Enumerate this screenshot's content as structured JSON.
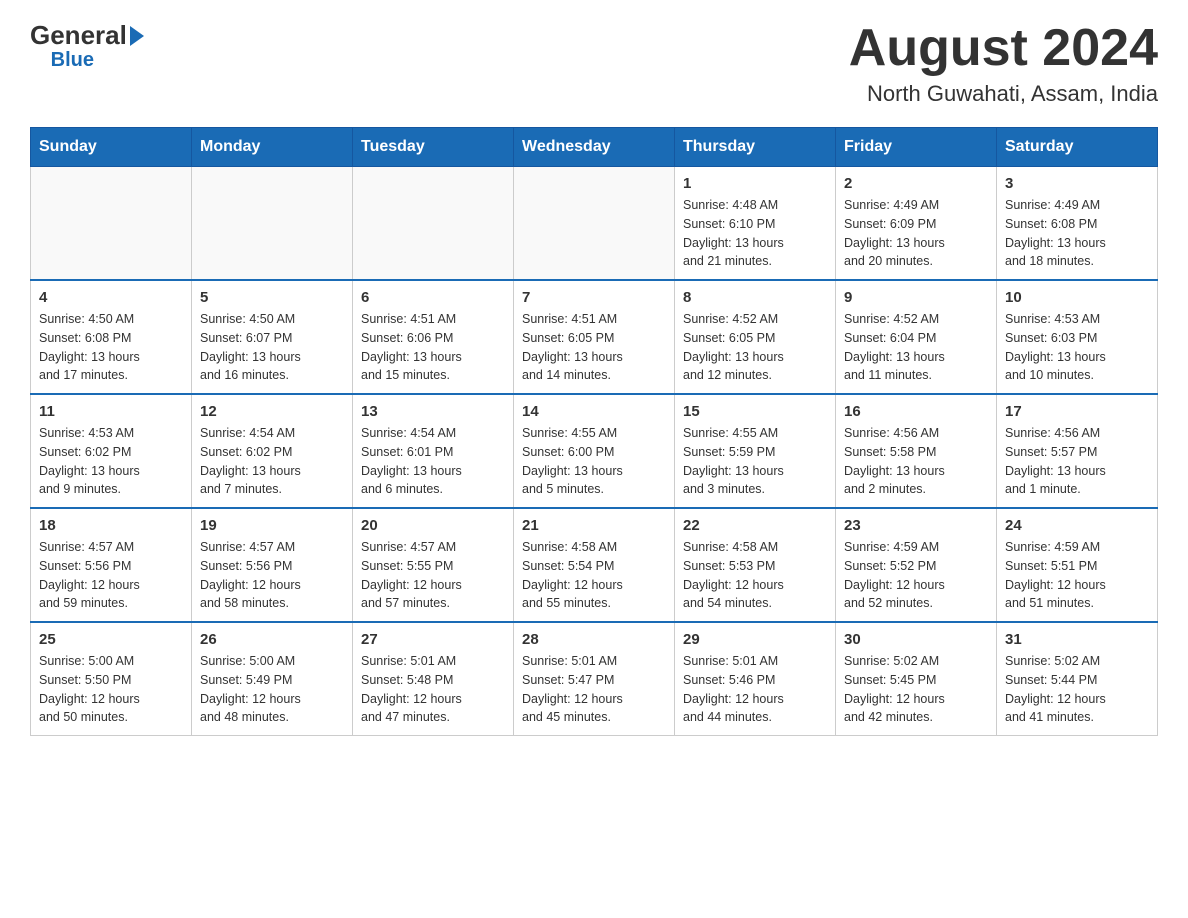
{
  "header": {
    "logo_general": "General",
    "logo_blue": "Blue",
    "main_title": "August 2024",
    "subtitle": "North Guwahati, Assam, India"
  },
  "days_of_week": [
    "Sunday",
    "Monday",
    "Tuesday",
    "Wednesday",
    "Thursday",
    "Friday",
    "Saturday"
  ],
  "weeks": [
    {
      "days": [
        {
          "number": "",
          "info": ""
        },
        {
          "number": "",
          "info": ""
        },
        {
          "number": "",
          "info": ""
        },
        {
          "number": "",
          "info": ""
        },
        {
          "number": "1",
          "info": "Sunrise: 4:48 AM\nSunset: 6:10 PM\nDaylight: 13 hours\nand 21 minutes."
        },
        {
          "number": "2",
          "info": "Sunrise: 4:49 AM\nSunset: 6:09 PM\nDaylight: 13 hours\nand 20 minutes."
        },
        {
          "number": "3",
          "info": "Sunrise: 4:49 AM\nSunset: 6:08 PM\nDaylight: 13 hours\nand 18 minutes."
        }
      ]
    },
    {
      "days": [
        {
          "number": "4",
          "info": "Sunrise: 4:50 AM\nSunset: 6:08 PM\nDaylight: 13 hours\nand 17 minutes."
        },
        {
          "number": "5",
          "info": "Sunrise: 4:50 AM\nSunset: 6:07 PM\nDaylight: 13 hours\nand 16 minutes."
        },
        {
          "number": "6",
          "info": "Sunrise: 4:51 AM\nSunset: 6:06 PM\nDaylight: 13 hours\nand 15 minutes."
        },
        {
          "number": "7",
          "info": "Sunrise: 4:51 AM\nSunset: 6:05 PM\nDaylight: 13 hours\nand 14 minutes."
        },
        {
          "number": "8",
          "info": "Sunrise: 4:52 AM\nSunset: 6:05 PM\nDaylight: 13 hours\nand 12 minutes."
        },
        {
          "number": "9",
          "info": "Sunrise: 4:52 AM\nSunset: 6:04 PM\nDaylight: 13 hours\nand 11 minutes."
        },
        {
          "number": "10",
          "info": "Sunrise: 4:53 AM\nSunset: 6:03 PM\nDaylight: 13 hours\nand 10 minutes."
        }
      ]
    },
    {
      "days": [
        {
          "number": "11",
          "info": "Sunrise: 4:53 AM\nSunset: 6:02 PM\nDaylight: 13 hours\nand 9 minutes."
        },
        {
          "number": "12",
          "info": "Sunrise: 4:54 AM\nSunset: 6:02 PM\nDaylight: 13 hours\nand 7 minutes."
        },
        {
          "number": "13",
          "info": "Sunrise: 4:54 AM\nSunset: 6:01 PM\nDaylight: 13 hours\nand 6 minutes."
        },
        {
          "number": "14",
          "info": "Sunrise: 4:55 AM\nSunset: 6:00 PM\nDaylight: 13 hours\nand 5 minutes."
        },
        {
          "number": "15",
          "info": "Sunrise: 4:55 AM\nSunset: 5:59 PM\nDaylight: 13 hours\nand 3 minutes."
        },
        {
          "number": "16",
          "info": "Sunrise: 4:56 AM\nSunset: 5:58 PM\nDaylight: 13 hours\nand 2 minutes."
        },
        {
          "number": "17",
          "info": "Sunrise: 4:56 AM\nSunset: 5:57 PM\nDaylight: 13 hours\nand 1 minute."
        }
      ]
    },
    {
      "days": [
        {
          "number": "18",
          "info": "Sunrise: 4:57 AM\nSunset: 5:56 PM\nDaylight: 12 hours\nand 59 minutes."
        },
        {
          "number": "19",
          "info": "Sunrise: 4:57 AM\nSunset: 5:56 PM\nDaylight: 12 hours\nand 58 minutes."
        },
        {
          "number": "20",
          "info": "Sunrise: 4:57 AM\nSunset: 5:55 PM\nDaylight: 12 hours\nand 57 minutes."
        },
        {
          "number": "21",
          "info": "Sunrise: 4:58 AM\nSunset: 5:54 PM\nDaylight: 12 hours\nand 55 minutes."
        },
        {
          "number": "22",
          "info": "Sunrise: 4:58 AM\nSunset: 5:53 PM\nDaylight: 12 hours\nand 54 minutes."
        },
        {
          "number": "23",
          "info": "Sunrise: 4:59 AM\nSunset: 5:52 PM\nDaylight: 12 hours\nand 52 minutes."
        },
        {
          "number": "24",
          "info": "Sunrise: 4:59 AM\nSunset: 5:51 PM\nDaylight: 12 hours\nand 51 minutes."
        }
      ]
    },
    {
      "days": [
        {
          "number": "25",
          "info": "Sunrise: 5:00 AM\nSunset: 5:50 PM\nDaylight: 12 hours\nand 50 minutes."
        },
        {
          "number": "26",
          "info": "Sunrise: 5:00 AM\nSunset: 5:49 PM\nDaylight: 12 hours\nand 48 minutes."
        },
        {
          "number": "27",
          "info": "Sunrise: 5:01 AM\nSunset: 5:48 PM\nDaylight: 12 hours\nand 47 minutes."
        },
        {
          "number": "28",
          "info": "Sunrise: 5:01 AM\nSunset: 5:47 PM\nDaylight: 12 hours\nand 45 minutes."
        },
        {
          "number": "29",
          "info": "Sunrise: 5:01 AM\nSunset: 5:46 PM\nDaylight: 12 hours\nand 44 minutes."
        },
        {
          "number": "30",
          "info": "Sunrise: 5:02 AM\nSunset: 5:45 PM\nDaylight: 12 hours\nand 42 minutes."
        },
        {
          "number": "31",
          "info": "Sunrise: 5:02 AM\nSunset: 5:44 PM\nDaylight: 12 hours\nand 41 minutes."
        }
      ]
    }
  ]
}
